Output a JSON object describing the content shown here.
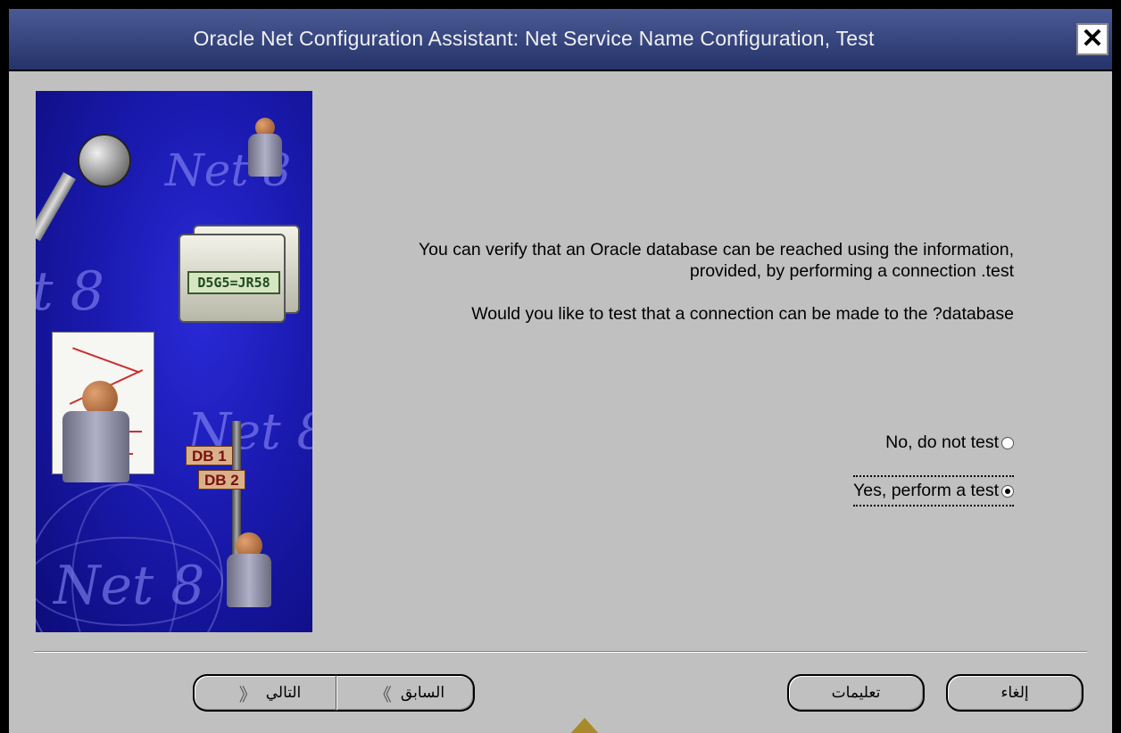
{
  "window": {
    "title": "Oracle Net Configuration Assistant: Net Service Name Configuration, Test",
    "close_glyph": "✕"
  },
  "side_image": {
    "label_net8": "Net 8",
    "label_folder": "D5G5=JR58",
    "sign_db1": "DB 1",
    "sign_db2": "DB 2"
  },
  "content": {
    "paragraph1": ",You can verify that an Oracle database can be reached using the information provided, by performing a connection .test",
    "paragraph2": "Would you like to test that a connection can be made to the ?database",
    "option_no": "No, do not test",
    "option_yes": "Yes, perform a test",
    "selected": "yes"
  },
  "buttons": {
    "next": "التالي",
    "back": "السابق",
    "help": "تعليمات",
    "cancel": "إلغاء"
  },
  "icons": {
    "next_chevron": "chevron-left-icon",
    "back_chevron": "chevron-right-icon"
  },
  "colors": {
    "title_bar": "#3a4880",
    "dialog_bg": "#c0c0c0",
    "image_bg": "#1a1ab0"
  }
}
